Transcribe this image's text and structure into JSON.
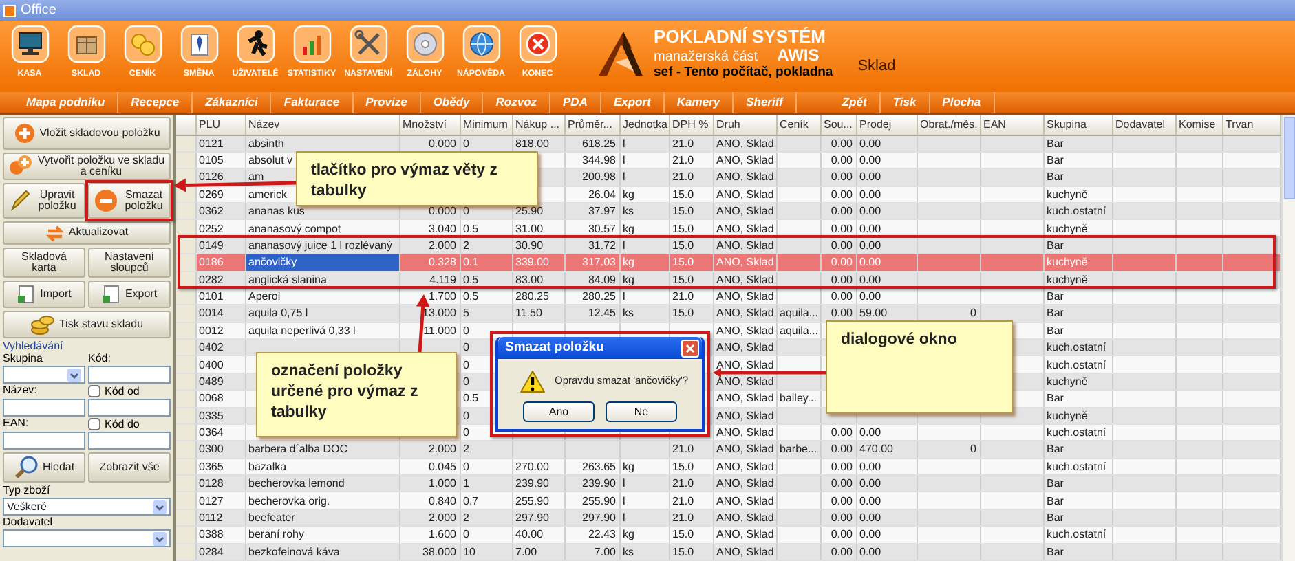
{
  "window": {
    "title": "Office"
  },
  "toolbar": [
    {
      "label": "KASA"
    },
    {
      "label": "SKLAD"
    },
    {
      "label": "CENÍK"
    },
    {
      "label": "SMĚNA"
    },
    {
      "label": "UŽIVATELÉ"
    },
    {
      "label": "STATISTIKY"
    },
    {
      "label": "NASTAVENÍ"
    },
    {
      "label": "ZÁLOHY"
    },
    {
      "label": "NÁPOVĚDA"
    },
    {
      "label": "KONEC"
    }
  ],
  "brand": {
    "title": "POKLADNÍ SYSTÉM",
    "subtitle": "manažerská část",
    "name": "AWIS",
    "user": "sef  -  Tento počítač, pokladna",
    "module": "Sklad"
  },
  "menu": [
    {
      "label": "Mapa podniku"
    },
    {
      "label": "Recepce"
    },
    {
      "label": "Zákazníci"
    },
    {
      "label": "Fakturace"
    },
    {
      "label": "Provize"
    },
    {
      "label": "Obědy"
    },
    {
      "label": "Rozvoz"
    },
    {
      "label": "PDA"
    },
    {
      "label": "Export"
    },
    {
      "label": "Kamery"
    },
    {
      "label": "Sheriff"
    },
    {
      "label": "Zpět"
    },
    {
      "label": "Tisk"
    },
    {
      "label": "Plocha"
    }
  ],
  "side_panel": {
    "buttons": [
      {
        "label": "Vložit skladovou položku"
      },
      {
        "label": "Vytvořit položku ve skladu a ceníku"
      },
      {
        "label": "Upravit položku"
      },
      {
        "label": "Smazat položku"
      },
      {
        "label": "Aktualizovat"
      },
      {
        "label": "Skladová karta"
      },
      {
        "label": "Nastavení sloupců"
      },
      {
        "label": "Import"
      },
      {
        "label": "Export"
      },
      {
        "label": "Tisk stavu skladu"
      }
    ],
    "search": {
      "title": "Vyhledávání",
      "group_label": "Skupina",
      "code_label": "Kód:",
      "name_label": "Název:",
      "code_from": {
        "label": "Kód od",
        "checked": false
      },
      "ean_label": "EAN:",
      "code_to": {
        "label": "Kód do",
        "checked": false
      },
      "search_button": "Hledat",
      "show_all_button": "Zobrazit vše",
      "goods_type_label": "Typ zboží",
      "goods_type_value": "Veškeré",
      "supplier_label": "Dodavatel"
    }
  },
  "table": {
    "columns": [
      "PLU",
      "Název",
      "Množství",
      "Minimum",
      "Nákup ...",
      "Průměr...",
      "Jednotka",
      "DPH %",
      "Druh",
      "Ceník",
      "Sou...",
      "Prodej",
      "Obrat./měs.",
      "EAN",
      "Skupina",
      "Dodavatel",
      "Komise",
      "Trvan"
    ],
    "rows": [
      {
        "selected": false,
        "cells": {
          "plu": "0121",
          "name": "absinth",
          "quantity": "0.000",
          "minimum": "0",
          "purchase": "818.00",
          "average": "618.25",
          "unit": "l",
          "vat": "21.0",
          "type": "ANO, Sklad",
          "sou": "0.00",
          "sale": "0.00",
          "group": "Bar"
        }
      },
      {
        "selected": false,
        "cells": {
          "plu": "0105",
          "name": "absolut v",
          "average": "344.98",
          "unit": "l",
          "vat": "21.0",
          "type": "ANO, Sklad",
          "sou": "0.00",
          "sale": "0.00",
          "group": "Bar"
        }
      },
      {
        "selected": false,
        "cells": {
          "plu": "0126",
          "name": "am",
          "average": "200.98",
          "unit": "l",
          "vat": "21.0",
          "type": "ANO, Sklad",
          "sou": "0.00",
          "sale": "0.00",
          "group": "Bar"
        }
      },
      {
        "selected": false,
        "cells": {
          "plu": "0269",
          "name": "americk",
          "average": "26.04",
          "unit": "kg",
          "vat": "15.0",
          "type": "ANO, Sklad",
          "sou": "0.00",
          "sale": "0.00",
          "group": "kuchyně"
        }
      },
      {
        "selected": false,
        "cells": {
          "plu": "0362",
          "name": "ananas kus",
          "quantity": "0.000",
          "minimum": "0",
          "purchase": "25.90",
          "average": "37.97",
          "unit": "ks",
          "vat": "15.0",
          "type": "ANO, Sklad",
          "sou": "0.00",
          "sale": "0.00",
          "group": "kuch.ostatní"
        }
      },
      {
        "selected": false,
        "cells": {
          "plu": "0252",
          "name": "ananasový compot",
          "quantity": "3.040",
          "minimum": "0.5",
          "purchase": "31.00",
          "average": "30.57",
          "unit": "kg",
          "vat": "15.0",
          "type": "ANO, Sklad",
          "sou": "0.00",
          "sale": "0.00",
          "group": "kuchyně"
        }
      },
      {
        "selected": false,
        "cells": {
          "plu": "0149",
          "name": "ananasový juice 1 l rozlévaný",
          "quantity": "2.000",
          "minimum": "2",
          "purchase": "30.90",
          "average": "31.72",
          "unit": "l",
          "vat": "15.0",
          "type": "ANO, Sklad",
          "sou": "0.00",
          "sale": "0.00",
          "group": "Bar"
        }
      },
      {
        "selected": true,
        "cells": {
          "plu": "0186",
          "name": "ančovičky",
          "quantity": "0.328",
          "minimum": "0.1",
          "purchase": "339.00",
          "average": "317.03",
          "unit": "kg",
          "vat": "15.0",
          "type": "ANO, Sklad",
          "sou": "0.00",
          "sale": "0.00",
          "group": "kuchyně"
        }
      },
      {
        "selected": false,
        "cells": {
          "plu": "0282",
          "name": "anglická slanina",
          "quantity": "4.119",
          "minimum": "0.5",
          "purchase": "83.00",
          "average": "84.09",
          "unit": "kg",
          "vat": "15.0",
          "type": "ANO, Sklad",
          "sou": "0.00",
          "sale": "0.00",
          "group": "kuchyně"
        }
      },
      {
        "selected": false,
        "cells": {
          "plu": "0101",
          "name": "Aperol",
          "quantity": "1.700",
          "minimum": "0.5",
          "purchase": "280.25",
          "average": "280.25",
          "unit": "l",
          "vat": "21.0",
          "type": "ANO, Sklad",
          "sou": "0.00",
          "sale": "0.00",
          "group": "Bar"
        }
      },
      {
        "selected": false,
        "cells": {
          "plu": "0014",
          "name": "aquila 0,75 l",
          "quantity": "13.000",
          "minimum": "5",
          "purchase": "11.50",
          "average": "12.45",
          "unit": "ks",
          "vat": "15.0",
          "type": "ANO, Sklad",
          "price_list": "aquila...",
          "sou": "0.00",
          "sale": "59.00",
          "turnover": "0",
          "group": "Bar"
        }
      },
      {
        "selected": false,
        "cells": {
          "plu": "0012",
          "name": "aquila neperlivá 0,33 l",
          "quantity": "11.000",
          "minimum": "0",
          "type": "ANO, Sklad",
          "price_list": "aquila...",
          "group": "Bar"
        }
      },
      {
        "selected": false,
        "cells": {
          "plu": "0402",
          "minimum": "0",
          "type": "ANO, Sklad",
          "group": "kuch.ostatní"
        }
      },
      {
        "selected": false,
        "cells": {
          "plu": "0400",
          "minimum": "0",
          "type": "ANO, Sklad",
          "group": "kuch.ostatní"
        }
      },
      {
        "selected": false,
        "cells": {
          "plu": "0489",
          "minimum": "0",
          "type": "ANO, Sklad",
          "group": "kuchyně"
        }
      },
      {
        "selected": false,
        "cells": {
          "plu": "0068",
          "minimum": "0.5",
          "type": "ANO, Sklad",
          "price_list": "bailey...",
          "group": "Bar"
        }
      },
      {
        "selected": false,
        "cells": {
          "plu": "0335",
          "minimum": "0",
          "type": "ANO, Sklad",
          "group": "kuchyně"
        }
      },
      {
        "selected": false,
        "cells": {
          "plu": "0364",
          "minimum": "0",
          "type": "ANO, Sklad",
          "sou": "0.00",
          "sale": "0.00",
          "group": "kuch.ostatní"
        }
      },
      {
        "selected": false,
        "cells": {
          "plu": "0300",
          "name": "barbera d´alba DOC",
          "quantity": "2.000",
          "minimum": "2",
          "vat": "21.0",
          "type": "ANO, Sklad",
          "price_list": "barbe...",
          "sou": "0.00",
          "sale": "470.00",
          "turnover": "0",
          "group": "Bar"
        }
      },
      {
        "selected": false,
        "cells": {
          "plu": "0365",
          "name": "bazalka",
          "quantity": "0.045",
          "minimum": "0",
          "purchase": "270.00",
          "average": "263.65",
          "unit": "kg",
          "vat": "15.0",
          "type": "ANO, Sklad",
          "sou": "0.00",
          "sale": "0.00",
          "group": "kuch.ostatní"
        }
      },
      {
        "selected": false,
        "cells": {
          "plu": "0128",
          "name": "becherovka lemond",
          "quantity": "1.000",
          "minimum": "1",
          "purchase": "239.90",
          "average": "239.90",
          "unit": "l",
          "vat": "21.0",
          "type": "ANO, Sklad",
          "sou": "0.00",
          "sale": "0.00",
          "group": "Bar"
        }
      },
      {
        "selected": false,
        "cells": {
          "plu": "0127",
          "name": "becherovka orig.",
          "quantity": "0.840",
          "minimum": "0.7",
          "purchase": "255.90",
          "average": "255.90",
          "unit": "l",
          "vat": "21.0",
          "type": "ANO, Sklad",
          "sou": "0.00",
          "sale": "0.00",
          "group": "Bar"
        }
      },
      {
        "selected": false,
        "cells": {
          "plu": "0112",
          "name": "beefeater",
          "quantity": "2.000",
          "minimum": "2",
          "purchase": "297.90",
          "average": "297.90",
          "unit": "l",
          "vat": "21.0",
          "type": "ANO, Sklad",
          "sou": "0.00",
          "sale": "0.00",
          "group": "Bar"
        }
      },
      {
        "selected": false,
        "cells": {
          "plu": "0388",
          "name": "beraní rohy",
          "quantity": "1.600",
          "minimum": "0",
          "purchase": "40.00",
          "average": "22.43",
          "unit": "kg",
          "vat": "15.0",
          "type": "ANO, Sklad",
          "sou": "0.00",
          "sale": "0.00",
          "group": "kuch.ostatní"
        }
      },
      {
        "selected": false,
        "cells": {
          "plu": "0284",
          "name": "bezkofeinová káva",
          "quantity": "38.000",
          "minimum": "10",
          "purchase": "7.00",
          "average": "7.00",
          "unit": "ks",
          "vat": "15.0",
          "type": "ANO, Sklad",
          "sou": "0.00",
          "sale": "0.00",
          "group": "Bar"
        }
      }
    ]
  },
  "dialog": {
    "title": "Smazat položku",
    "message": "Opravdu smazat 'ančovičky'?",
    "buttons": [
      {
        "label": "Ano"
      },
      {
        "label": "Ne"
      }
    ]
  },
  "annotations": [
    {
      "text": "tlačítko pro výmaz věty z tabulky"
    },
    {
      "text": "označení položky určené pro výmaz z tabulky"
    },
    {
      "text": "dialogové okno"
    }
  ]
}
